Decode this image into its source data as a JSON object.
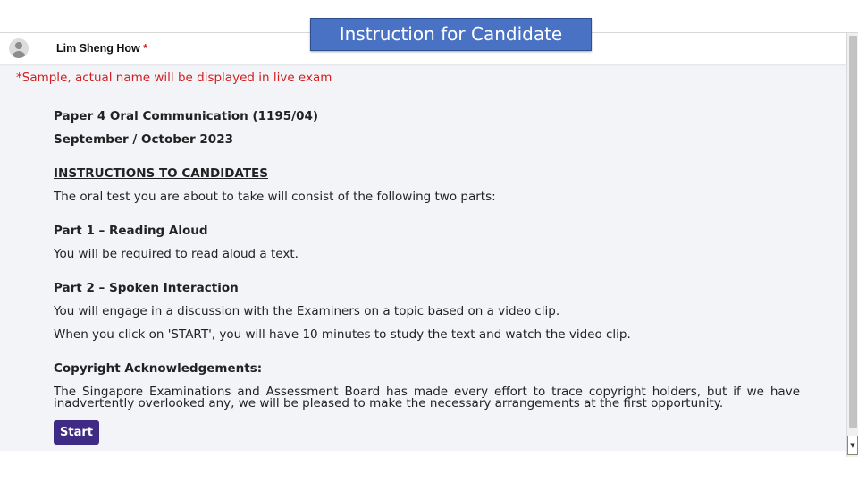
{
  "header": {
    "title": "Instruction for Candidate"
  },
  "user": {
    "name": "Lim Sheng How",
    "required_mark": "*"
  },
  "sample_note": "*Sample, actual name will be displayed in live exam",
  "exam": {
    "paper": "Paper 4 Oral Communication (1195/04)",
    "session": "September / October 2023"
  },
  "instructions": {
    "heading": "INSTRUCTIONS TO CANDIDATES",
    "intro": "The oral test you are about to take will consist of the following two parts:",
    "part1": {
      "title": "Part 1 – Reading Aloud",
      "text": "You will be required to read aloud a text."
    },
    "part2": {
      "title": "Part 2 – Spoken Interaction",
      "text1": "You will engage in a discussion with the Examiners on a topic based on a video clip.",
      "text2": "When you click on 'START', you will have 10 minutes to study the text and watch the video clip."
    }
  },
  "copyright": {
    "title": "Copyright Acknowledgements:",
    "text": "The Singapore Examinations and Assessment Board has made every effort to trace copyright holders, but if we have inadvertently overlooked any, we will be pleased to make the necessary arrangements at the first opportunity."
  },
  "actions": {
    "start_label": "Start"
  },
  "icons": {
    "avatar": "user-avatar-icon",
    "scroll_down": "scroll-down-arrow-icon"
  },
  "colors": {
    "title_banner": "#4a72c4",
    "start_button": "#3f2b86",
    "sample_note": "#d21f1f",
    "required_mark": "#e01b1b",
    "content_background": "#f2f4f8"
  }
}
